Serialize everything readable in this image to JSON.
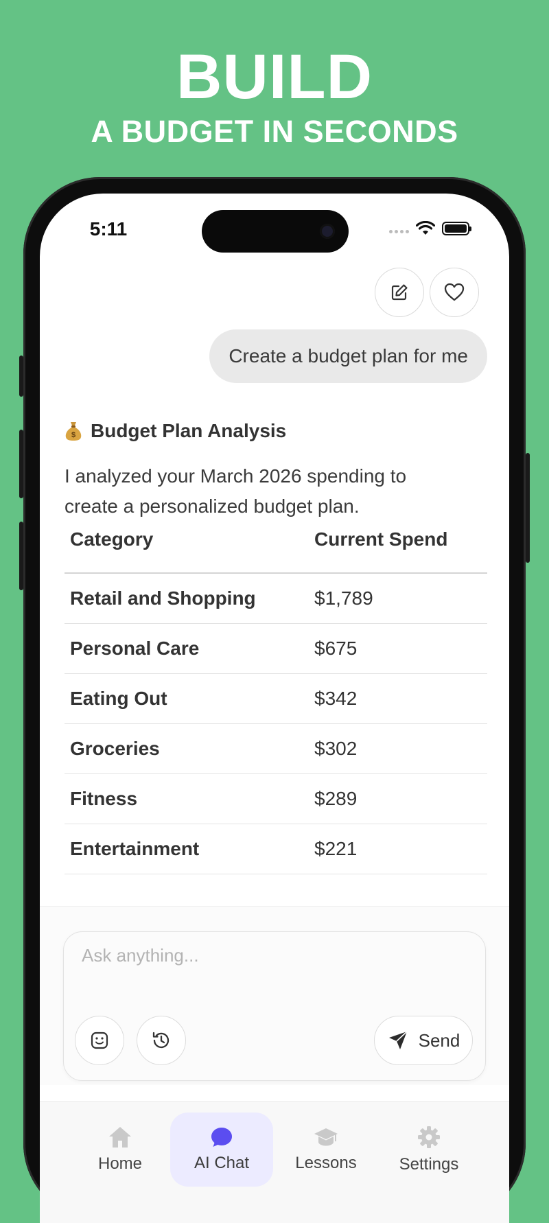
{
  "promo": {
    "headline": "BUILD",
    "subheadline": "A BUDGET IN SECONDS",
    "background_color": "#64c285"
  },
  "status_bar": {
    "time": "5:11"
  },
  "toolbar": {
    "icons": [
      "edit-icon",
      "heart-icon"
    ]
  },
  "chat": {
    "user_message": "Create a budget plan for me",
    "answer_emoji": "money-bag-icon",
    "answer_title": "Budget Plan Analysis",
    "answer_text": "I analyzed your March 2026 spending to create a personalized budget plan.",
    "table": {
      "headers": [
        "Category",
        "Current Spend"
      ],
      "rows": [
        [
          "Retail and Shopping",
          "$1,789"
        ],
        [
          "Personal Care",
          "$675"
        ],
        [
          "Eating Out",
          "$342"
        ],
        [
          "Groceries",
          "$302"
        ],
        [
          "Fitness",
          "$289"
        ],
        [
          "Entertainment",
          "$221"
        ]
      ]
    }
  },
  "composer": {
    "placeholder": "Ask anything...",
    "send_label": "Send"
  },
  "tabs": [
    {
      "label": "Home",
      "icon": "home-icon",
      "active": false
    },
    {
      "label": "AI Chat",
      "icon": "chat-bubble-icon",
      "active": true
    },
    {
      "label": "Lessons",
      "icon": "graduation-cap-icon",
      "active": false
    },
    {
      "label": "Settings",
      "icon": "gear-icon",
      "active": false
    }
  ],
  "colors": {
    "accent": "#5b4df0",
    "active_tab_bg": "#ecebff"
  }
}
